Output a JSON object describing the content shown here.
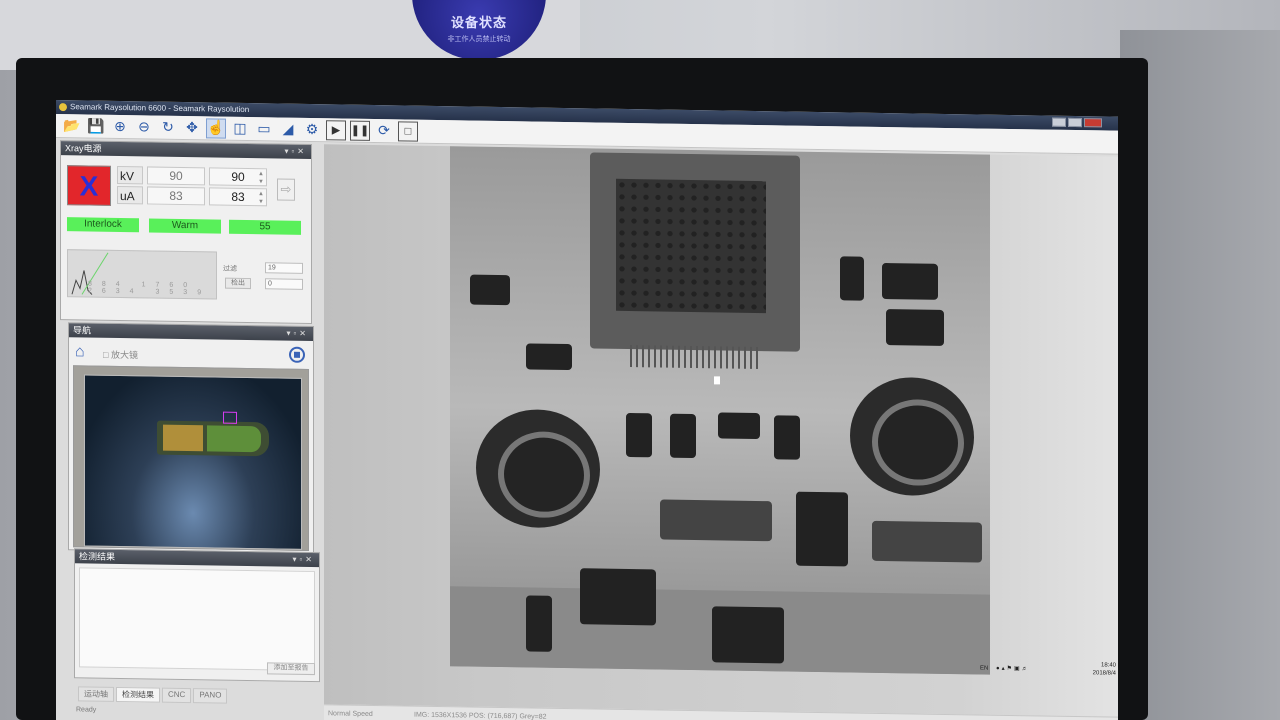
{
  "sticker": {
    "text": "设备状态",
    "sub": "非工作人员禁止转动"
  },
  "window": {
    "title": "Seamark Raysolution  6600 - Seamark Raysolution"
  },
  "toolbar": {
    "icons": [
      "open-folder-icon",
      "save-icon",
      "zoom-in-icon",
      "zoom-out-icon",
      "rotate-icon",
      "pan-icon",
      "select-icon",
      "camera-icon",
      "frame-icon",
      "measure-icon",
      "settings-icon",
      "play-icon",
      "pause-icon",
      "refresh-icon",
      "stop-icon"
    ]
  },
  "xray_panel": {
    "title": "Xray电源",
    "kv_label": "kV",
    "kv_actual": "90",
    "kv_set": "90",
    "ua_label": "uA",
    "ua_actual": "83",
    "ua_set": "83",
    "status_interlock": "Interlock",
    "status_warm": "Warm",
    "status_value": "55",
    "hist_ticks": "884   1760   2634   3539",
    "filter_label": "过滤",
    "filter_value": "19",
    "detect_button": "检出",
    "detect_value": "0"
  },
  "nav_panel": {
    "title": "导航",
    "zoom_label": "放大镜"
  },
  "result_panel": {
    "title": "检测结果",
    "add_report": "添加至报告"
  },
  "bottom_tabs": [
    "运动轴",
    "检测结果",
    "CNC",
    "PANO"
  ],
  "ready_text": "Ready",
  "statusbar": {
    "speed": "Normal Speed",
    "pos": "IMG: 1536X1536   POS: (716,687)  Grey=82"
  },
  "taskbar": {
    "lang": "EN",
    "time": "18:40",
    "date": "2018/8/4"
  },
  "colors": {
    "status_green": "#59f05a",
    "xray_red": "#e2262b",
    "accent_blue": "#3a63b7"
  }
}
